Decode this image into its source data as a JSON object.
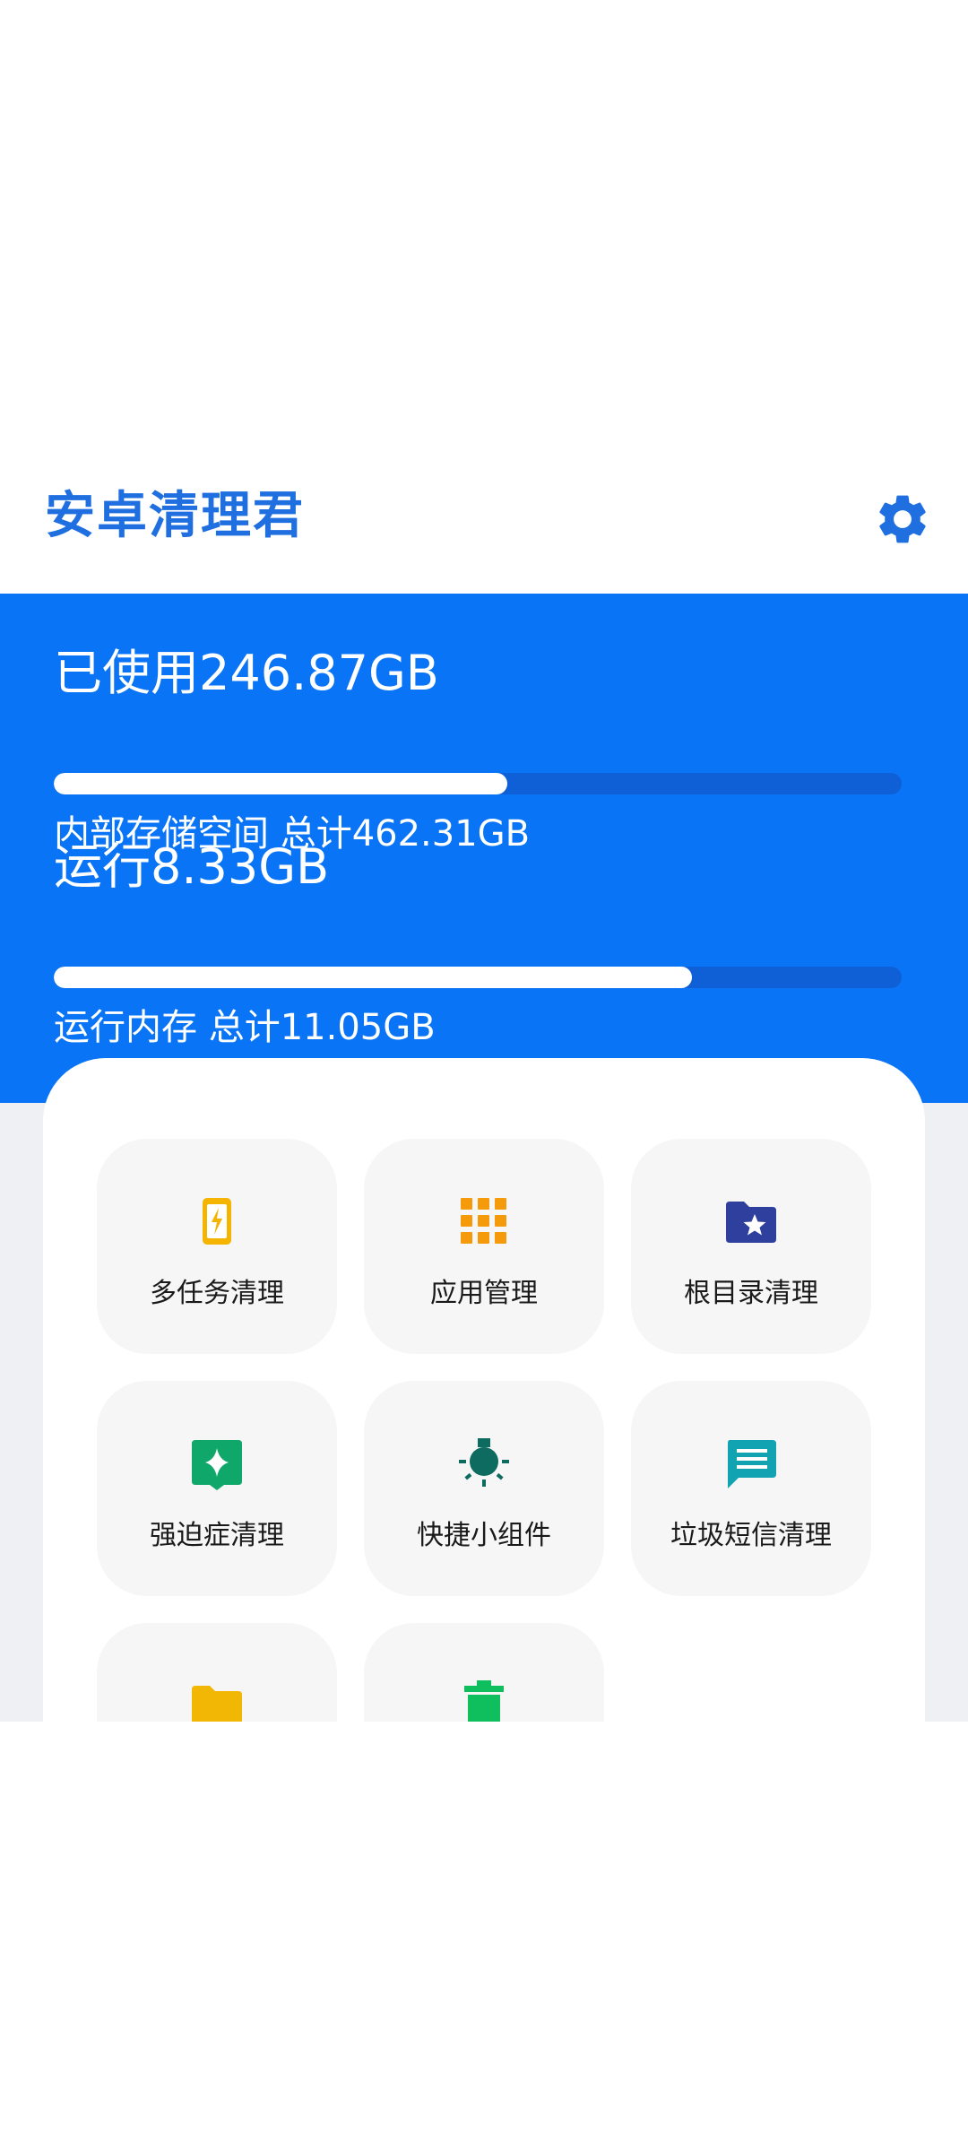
{
  "header": {
    "title": "安卓清理君",
    "settings_icon": "gear-icon"
  },
  "storage": {
    "used_label": "已使用246.87GB",
    "used_fraction": 0.535,
    "total_label": "内部存储空间 总计462.31GB"
  },
  "memory": {
    "used_label": "运行8.33GB",
    "used_fraction": 0.753,
    "total_label": "运行内存 总计11.05GB"
  },
  "tools": [
    {
      "label": "多任务清理",
      "icon": "phone-bolt-icon",
      "color": "#f5b400"
    },
    {
      "label": "应用管理",
      "icon": "app-grid-icon",
      "color": "#f59a0a"
    },
    {
      "label": "根目录清理",
      "icon": "folder-star-icon",
      "color": "#2f3f9e"
    },
    {
      "label": "强迫症清理",
      "icon": "sparkle-bubble-icon",
      "color": "#10a86a"
    },
    {
      "label": "快捷小组件",
      "icon": "bulb-icon",
      "color": "#0d6b5f"
    },
    {
      "label": "垃圾短信清理",
      "icon": "message-icon",
      "color": "#12a3b2"
    },
    {
      "label": "",
      "icon": "folder-icon",
      "color": "#f2b705"
    },
    {
      "label": "",
      "icon": "trash-icon",
      "color": "#0fbf5e"
    }
  ],
  "colors": {
    "accent": "#0a74f6",
    "title": "#1f6fe0"
  }
}
